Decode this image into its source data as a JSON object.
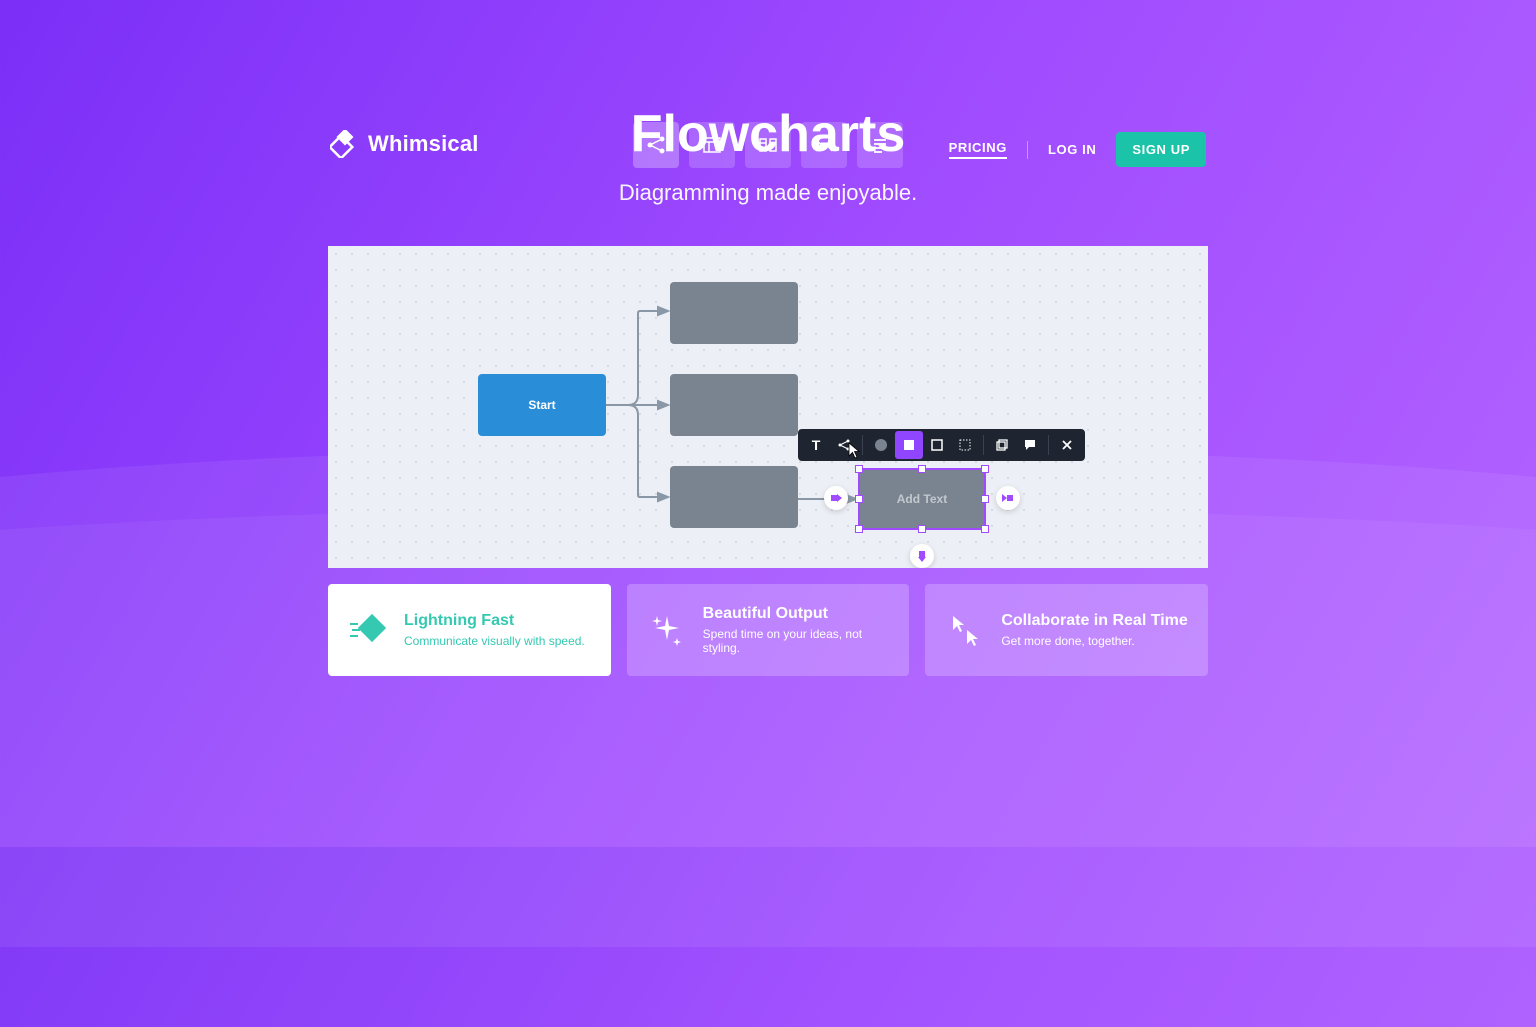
{
  "brand": "Whimsical",
  "nav": {
    "pricing": "PRICING",
    "login": "LOG IN",
    "signup": "SIGN UP"
  },
  "hero": {
    "title": "Flowcharts",
    "subtitle": "Diagramming made enjoyable."
  },
  "canvas": {
    "start_label": "Start",
    "add_text": "Add Text"
  },
  "features": [
    {
      "title": "Lightning Fast",
      "desc": "Communicate visually with speed."
    },
    {
      "title": "Beautiful Output",
      "desc": "Spend time on your ideas, not styling."
    },
    {
      "title": "Collaborate in Real Time",
      "desc": "Get more done, together."
    }
  ]
}
